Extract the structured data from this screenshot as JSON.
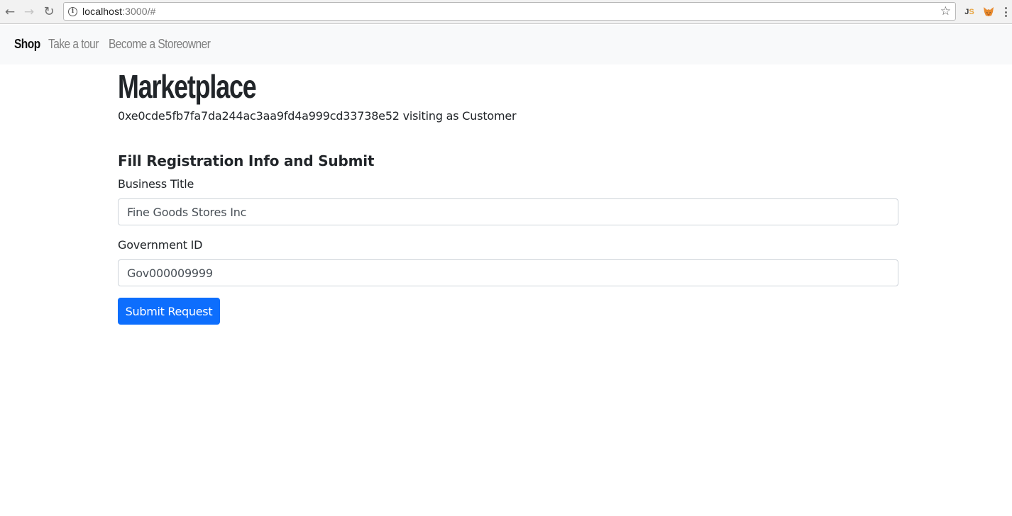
{
  "browser": {
    "url_host": "localhost",
    "url_path": ":3000/#",
    "back_icon": "arrow-left-icon",
    "forward_icon": "arrow-right-icon",
    "reload_icon": "reload-icon",
    "info_icon": "info-icon",
    "star_icon": "star-icon",
    "extensions": [
      "js-extension-icon",
      "metamask-fox-icon"
    ],
    "menu_icon": "kebab-menu-icon"
  },
  "navbar": {
    "items": [
      {
        "label": "Shop",
        "active": true
      },
      {
        "label": "Take a tour",
        "active": false
      },
      {
        "label": "Become a Storeowner",
        "active": false
      }
    ]
  },
  "page": {
    "title": "Marketplace",
    "visitor_line": "0xe0cde5fb7fa7da244ac3aa9fd4a999cd33738e52 visiting as Customer"
  },
  "form": {
    "heading": "Fill Registration Info and Submit",
    "business_title_label": "Business Title",
    "business_title_value": "Fine Goods Stores Inc",
    "government_id_label": "Government ID",
    "government_id_value": "Gov000009999",
    "submit_label": "Submit Request"
  },
  "colors": {
    "primary": "#0d6efd",
    "navbar_bg": "#f8f9fa",
    "text": "#212529",
    "muted": "#808080"
  }
}
